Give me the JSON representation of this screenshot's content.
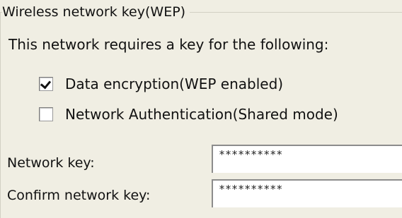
{
  "group": {
    "title": "Wireless network key(WEP)"
  },
  "description": "This network requires a key for the following:",
  "options": [
    {
      "label": "Data encryption(WEP enabled)",
      "checked": true
    },
    {
      "label": "Network Authentication(Shared mode)",
      "checked": false
    }
  ],
  "fields": {
    "network_key": {
      "label": "Network key:",
      "value": "**********"
    },
    "confirm_key": {
      "label": "Confirm network key:",
      "value": "**********"
    }
  },
  "colors": {
    "background": "#f0eee3",
    "group_border": "#d2d0c4",
    "input_border": "#8c8c8c"
  }
}
